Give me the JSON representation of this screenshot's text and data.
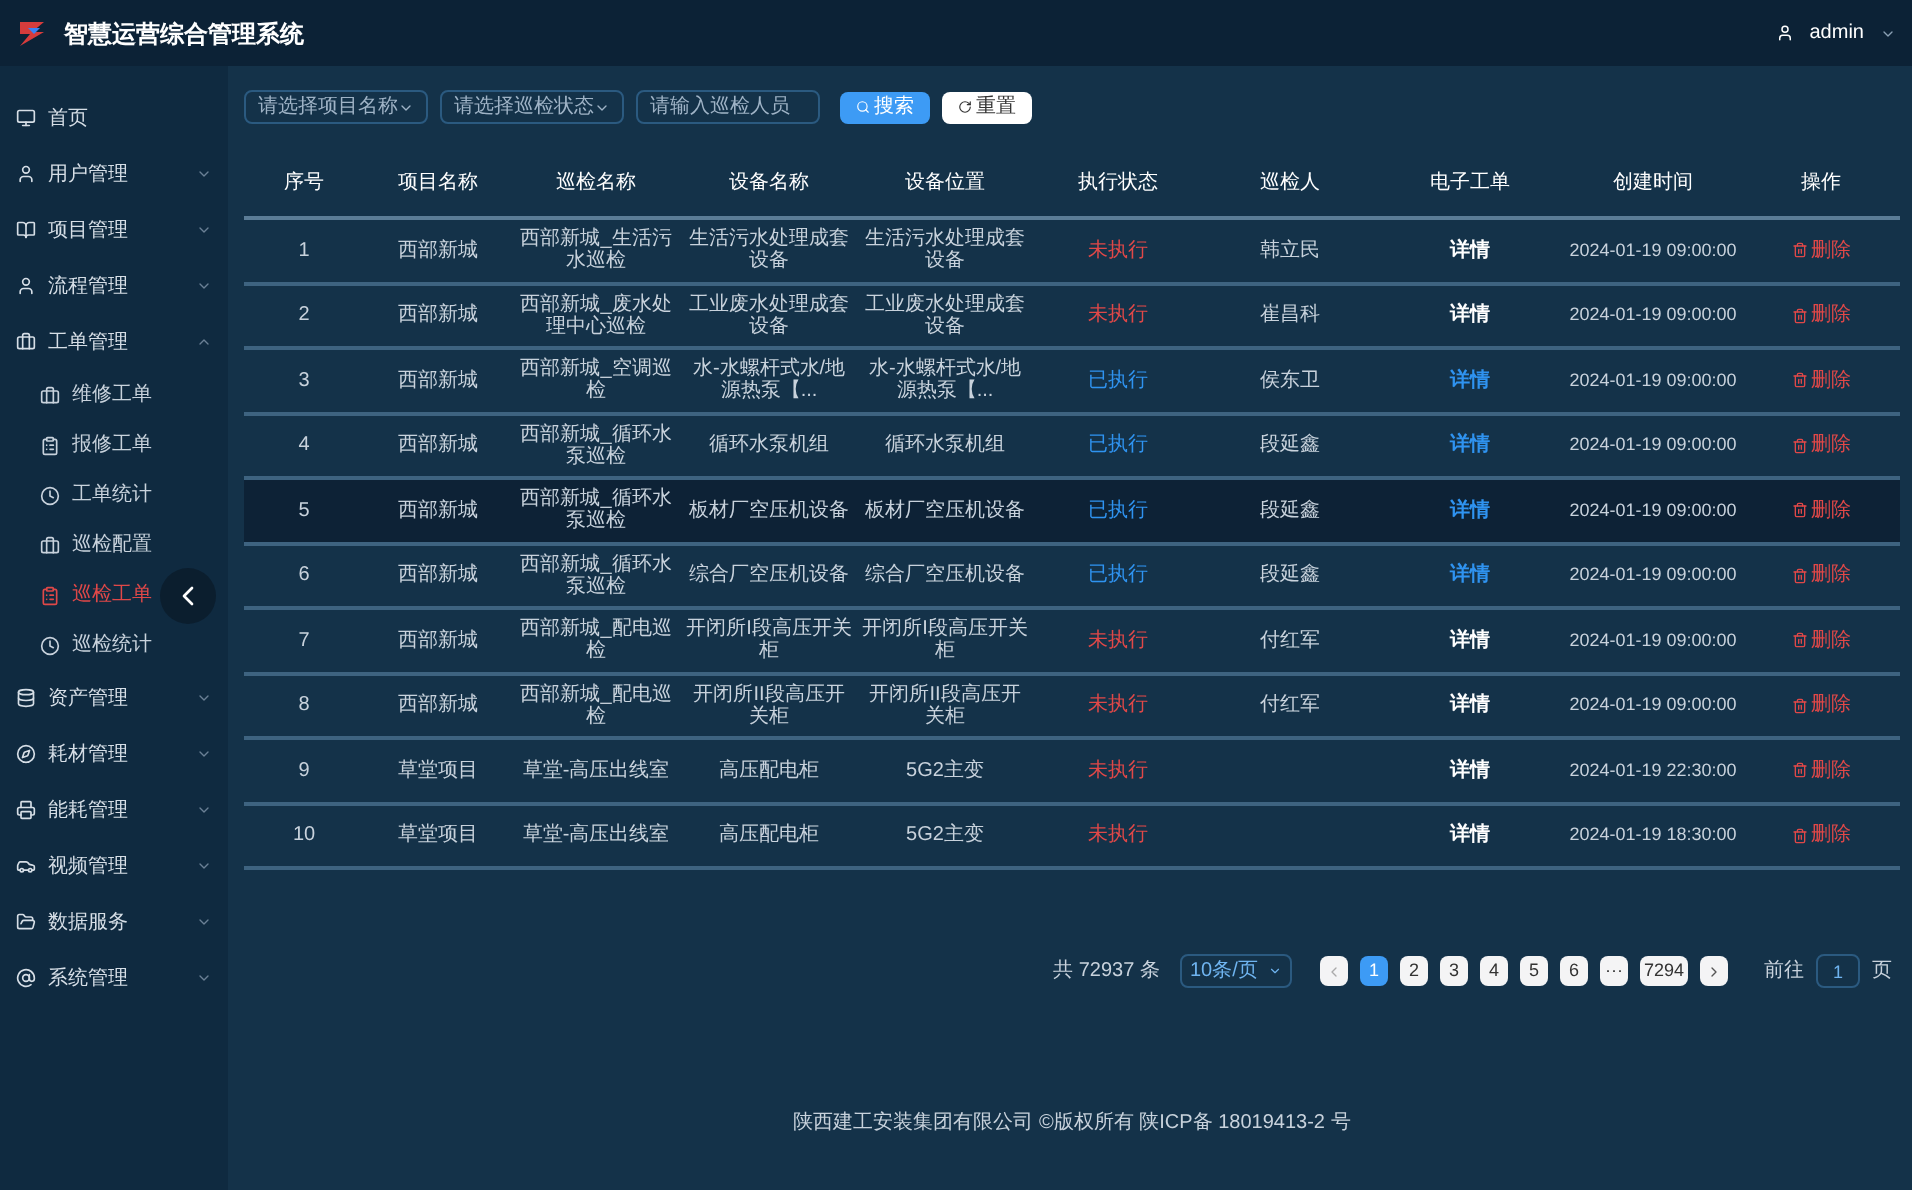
{
  "header": {
    "title": "智慧运营综合管理系统",
    "user": "admin"
  },
  "sidebar": {
    "items": [
      {
        "label": "首页"
      },
      {
        "label": "用户管理",
        "expanded": false
      },
      {
        "label": "项目管理",
        "expanded": false
      },
      {
        "label": "流程管理",
        "expanded": false
      },
      {
        "label": "工单管理",
        "expanded": true,
        "children": [
          {
            "label": "维修工单",
            "selected": false
          },
          {
            "label": "报修工单",
            "selected": false
          },
          {
            "label": "工单统计",
            "selected": false
          },
          {
            "label": "巡检配置",
            "selected": false
          },
          {
            "label": "巡检工单",
            "selected": true
          },
          {
            "label": "巡检统计",
            "selected": false
          }
        ]
      },
      {
        "label": "资产管理",
        "expanded": false
      },
      {
        "label": "耗材管理",
        "expanded": false
      },
      {
        "label": "能耗管理",
        "expanded": false
      },
      {
        "label": "视频管理",
        "expanded": false
      },
      {
        "label": "数据服务",
        "expanded": false
      },
      {
        "label": "系统管理",
        "expanded": false
      }
    ]
  },
  "filters": {
    "project": {
      "placeholder": "请选择项目名称"
    },
    "status": {
      "placeholder": "请选择巡检状态"
    },
    "inspector": {
      "placeholder": "请输入巡检人员"
    },
    "search_button": "搜索",
    "reset_button": "重置"
  },
  "table": {
    "columns": [
      "序号",
      "项目名称",
      "巡检名称",
      "设备名称",
      "设备位置",
      "执行状态",
      "巡检人",
      "电子工单",
      "创建时间",
      "操作"
    ],
    "rows": [
      {
        "no": "1",
        "project": "西部新城",
        "name": "西部新城_生活污水巡检",
        "device": "生活污水处理成套设备",
        "location": "生活污水处理成套设备",
        "status": "未执行",
        "kind": "pending",
        "inspector": "韩立民",
        "detail": "详情",
        "time": "2024-01-19 09:00:00",
        "action": "删除",
        "selected": false
      },
      {
        "no": "2",
        "project": "西部新城",
        "name": "西部新城_废水处理中心巡检",
        "device": "工业废水处理成套设备",
        "location": "工业废水处理成套设备",
        "status": "未执行",
        "kind": "pending",
        "inspector": "崔昌科",
        "detail": "详情",
        "time": "2024-01-19 09:00:00",
        "action": "删除",
        "selected": false
      },
      {
        "no": "3",
        "project": "西部新城",
        "name": "西部新城_空调巡检",
        "device": "水-水螺杆式水/地源热泵【...",
        "location": "水-水螺杆式水/地源热泵【...",
        "status": "已执行",
        "kind": "done",
        "inspector": "侯东卫",
        "detail": "详情",
        "time": "2024-01-19 09:00:00",
        "action": "删除",
        "selected": false
      },
      {
        "no": "4",
        "project": "西部新城",
        "name": "西部新城_循环水泵巡检",
        "device": "循环水泵机组",
        "location": "循环水泵机组",
        "status": "已执行",
        "kind": "done",
        "inspector": "段延鑫",
        "detail": "详情",
        "time": "2024-01-19 09:00:00",
        "action": "删除",
        "selected": false
      },
      {
        "no": "5",
        "project": "西部新城",
        "name": "西部新城_循环水泵巡检",
        "device": "板材厂空压机设备",
        "location": "板材厂空压机设备",
        "status": "已执行",
        "kind": "done",
        "inspector": "段延鑫",
        "detail": "详情",
        "time": "2024-01-19 09:00:00",
        "action": "删除",
        "selected": true
      },
      {
        "no": "6",
        "project": "西部新城",
        "name": "西部新城_循环水泵巡检",
        "device": "综合厂空压机设备",
        "location": "综合厂空压机设备",
        "status": "已执行",
        "kind": "done",
        "inspector": "段延鑫",
        "detail": "详情",
        "time": "2024-01-19 09:00:00",
        "action": "删除",
        "selected": false
      },
      {
        "no": "7",
        "project": "西部新城",
        "name": "西部新城_配电巡检",
        "device": "开闭所I段高压开关柜",
        "location": "开闭所I段高压开关柜",
        "status": "未执行",
        "kind": "pending",
        "inspector": "付红军",
        "detail": "详情",
        "time": "2024-01-19 09:00:00",
        "action": "删除",
        "selected": false
      },
      {
        "no": "8",
        "project": "西部新城",
        "name": "西部新城_配电巡检",
        "device": "开闭所II段高压开关柜",
        "location": "开闭所II段高压开关柜",
        "status": "未执行",
        "kind": "pending",
        "inspector": "付红军",
        "detail": "详情",
        "time": "2024-01-19 09:00:00",
        "action": "删除",
        "selected": false
      },
      {
        "no": "9",
        "project": "草堂项目",
        "name": "草堂-高压出线室",
        "device": "高压配电柜",
        "location": "5G2主变",
        "status": "未执行",
        "kind": "pending",
        "detail": "详情",
        "time": "2024-01-19 22:30:00",
        "action": "删除",
        "selected": false
      },
      {
        "no": "10",
        "project": "草堂项目",
        "name": "草堂-高压出线室",
        "device": "高压配电柜",
        "location": "5G2主变",
        "status": "未执行",
        "kind": "pending",
        "detail": "详情",
        "time": "2024-01-19 18:30:00",
        "action": "删除",
        "selected": false
      }
    ]
  },
  "pagination": {
    "total": "共 72937 条",
    "page_size": "10条/页",
    "pages": [
      {
        "label": "1",
        "selected": true
      },
      {
        "label": "2",
        "selected": false
      },
      {
        "label": "3",
        "selected": false
      },
      {
        "label": "4",
        "selected": false
      },
      {
        "label": "5",
        "selected": false
      },
      {
        "label": "6",
        "selected": false
      },
      {
        "label": "···",
        "selected": false
      },
      {
        "label": "7294",
        "selected": false
      }
    ],
    "goto_label": "前往",
    "goto_value": "1",
    "goto_suffix": "页"
  },
  "footer": "陕西建工安装集团有限公司 ©版权所有 陕ICP备 18019413-2 号"
}
